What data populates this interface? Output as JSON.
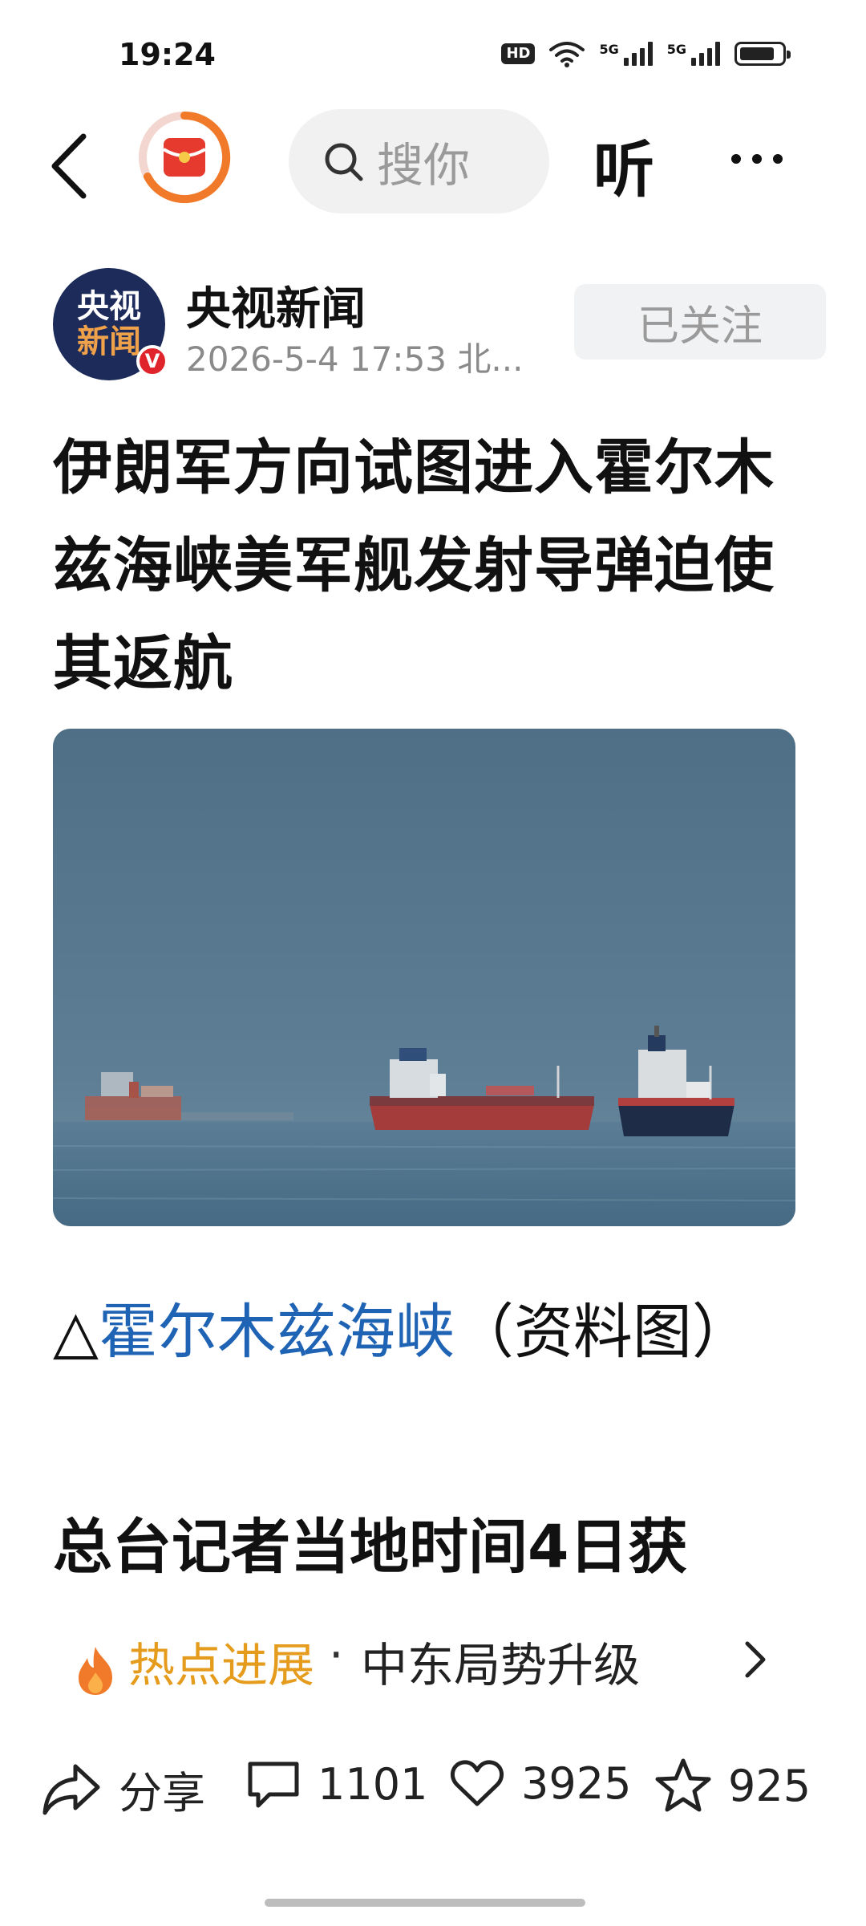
{
  "status_bar": {
    "time": "19:24",
    "hd_label": "HD",
    "net1": "5G",
    "net2": "5G",
    "battery_level": 0.72
  },
  "nav": {
    "search_placeholder": "搜你",
    "listen_label": "听",
    "brand_color": "#e63a2e"
  },
  "author": {
    "name": "央视新闻",
    "avatar_line1": "央视",
    "avatar_line2": "新闻",
    "verified_mark": "V",
    "meta": "2026-5-4  17:53  北...",
    "follow_label": "已关注"
  },
  "article": {
    "headline": "伊朗军方向试图进入霍尔木兹海峡美军舰发射导弹迫使其返航",
    "caption_prefix": "△",
    "caption_link": "霍尔木兹海峡",
    "caption_suffix": "（资料图）",
    "body_preview": "总台记者当地时间4日获"
  },
  "hot_topic": {
    "label": "热点进展",
    "separator": "·",
    "topic": "中东局势升级",
    "label_color": "#e59b1b"
  },
  "actions": {
    "share_label": "分享",
    "comments": "1101",
    "likes": "3925",
    "favorites": "925"
  }
}
